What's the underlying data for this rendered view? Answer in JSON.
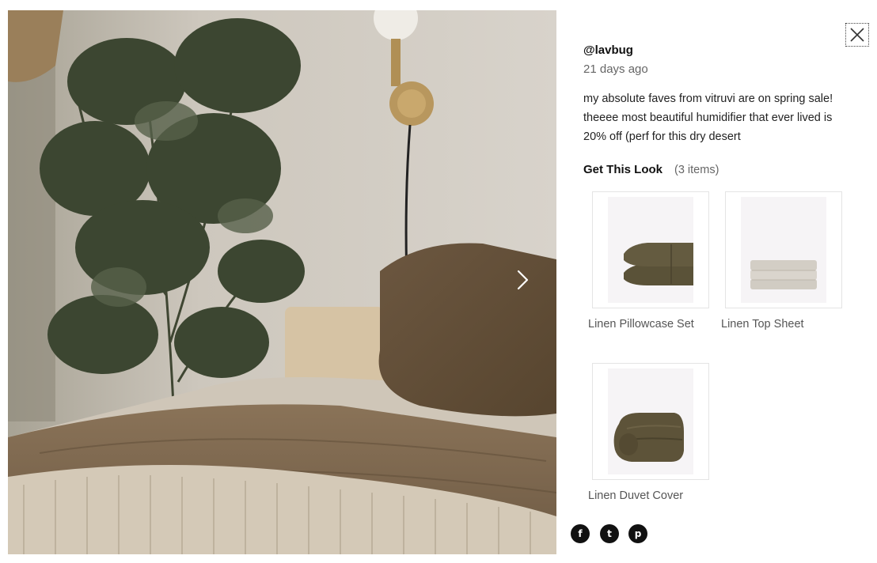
{
  "post": {
    "username": "@lavbug",
    "timestamp": "21 days ago",
    "caption": "my absolute faves from vitruvi are on spring sale! theeee most beautiful humidifier that ever lived is 20% off (perf for this dry desert"
  },
  "look": {
    "heading": "Get This Look",
    "count": "(3 items)",
    "products": [
      {
        "name": "Linen Pillowcase Set",
        "icon": "pillowcase-image"
      },
      {
        "name": "Linen Top Sheet",
        "icon": "folded-sheet-image"
      },
      {
        "name": "Linen Duvet Cover",
        "icon": "duvet-image"
      }
    ]
  },
  "share": {
    "facebook": "f",
    "twitter": "t",
    "pinterest": "p"
  },
  "icons": {
    "close": "close-icon",
    "next": "chevron-right-icon"
  },
  "colors": {
    "accent": "#111111",
    "muted_text": "#666666",
    "card_border": "#e4e4e4"
  }
}
